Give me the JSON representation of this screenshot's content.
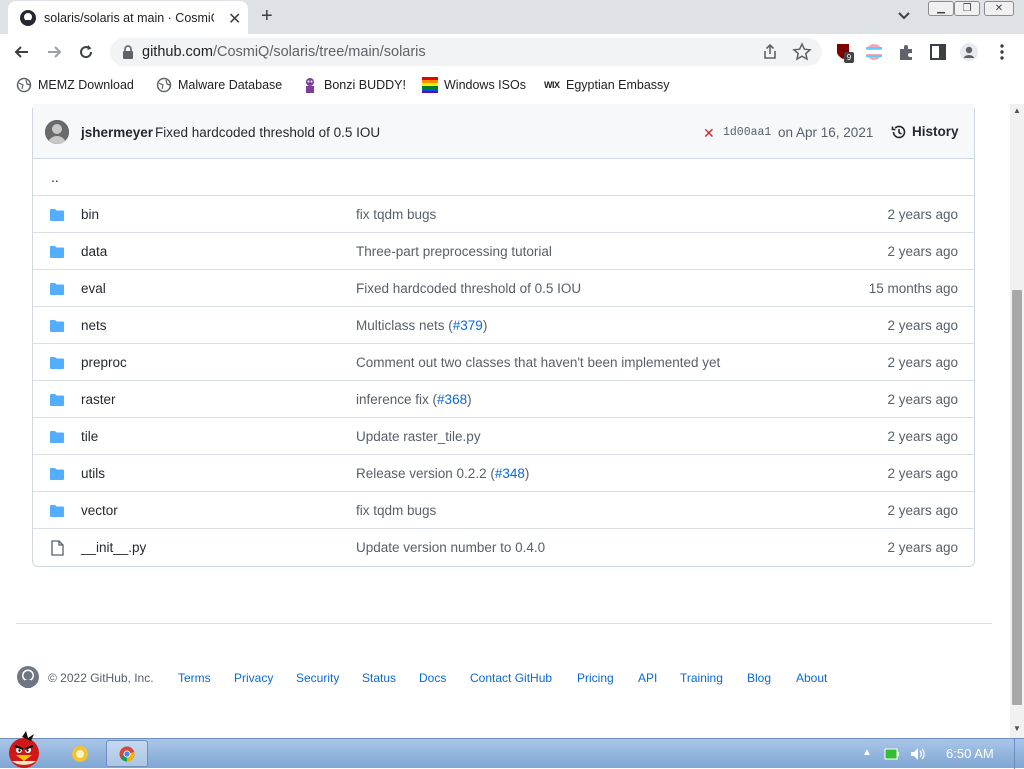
{
  "browser": {
    "tab_title": "solaris/solaris at main · CosmiQ",
    "url_domain": "github.com",
    "url_path": "/CosmiQ/solaris/tree/main/solaris",
    "extension_badge": "9",
    "bookmarks": [
      {
        "label": "MEMZ Download",
        "icon": "globe-icon"
      },
      {
        "label": "Malware Database",
        "icon": "globe-icon"
      },
      {
        "label": "Bonzi BUDDY!",
        "icon": "bonzi-icon"
      },
      {
        "label": "Windows ISOs",
        "icon": "windows-icon"
      },
      {
        "label": "Egyptian Embassy",
        "icon": "wix-icon"
      }
    ]
  },
  "commit": {
    "author": "jshermeyer",
    "message": "Fixed hardcoded threshold of 0.5 IOU",
    "status_symbol": "✕",
    "sha": "1d00aa1",
    "date": "on Apr 16, 2021",
    "history_label": "History"
  },
  "parent_dir": "..",
  "files": [
    {
      "name": "bin",
      "type": "folder",
      "message": "fix tqdm bugs",
      "link": "",
      "suffix": "",
      "age": "2 years ago"
    },
    {
      "name": "data",
      "type": "folder",
      "message": "Three-part preprocessing tutorial",
      "link": "",
      "suffix": "",
      "age": "2 years ago"
    },
    {
      "name": "eval",
      "type": "folder",
      "message": "Fixed hardcoded threshold of 0.5 IOU",
      "link": "",
      "suffix": "",
      "age": "15 months ago"
    },
    {
      "name": "nets",
      "type": "folder",
      "message": "Multiclass nets (",
      "link": "#379",
      "suffix": ")",
      "age": "2 years ago"
    },
    {
      "name": "preproc",
      "type": "folder",
      "message": "Comment out two classes that haven't been implemented yet",
      "link": "",
      "suffix": "",
      "age": "2 years ago"
    },
    {
      "name": "raster",
      "type": "folder",
      "message": "inference fix (",
      "link": "#368",
      "suffix": ")",
      "age": "2 years ago"
    },
    {
      "name": "tile",
      "type": "folder",
      "message": "Update raster_tile.py",
      "link": "",
      "suffix": "",
      "age": "2 years ago"
    },
    {
      "name": "utils",
      "type": "folder",
      "message": "Release version 0.2.2 (",
      "link": "#348",
      "suffix": ")",
      "age": "2 years ago"
    },
    {
      "name": "vector",
      "type": "folder",
      "message": "fix tqdm bugs",
      "link": "",
      "suffix": "",
      "age": "2 years ago"
    },
    {
      "name": "__init__.py",
      "type": "file",
      "message": "Update version number to 0.4.0",
      "link": "",
      "suffix": "",
      "age": "2 years ago"
    }
  ],
  "footer": {
    "copyright": "© 2022 GitHub, Inc.",
    "links": [
      "Terms",
      "Privacy",
      "Security",
      "Status",
      "Docs",
      "Contact GitHub",
      "Pricing",
      "API",
      "Training",
      "Blog",
      "About"
    ]
  },
  "taskbar": {
    "time": "6:50 AM"
  },
  "colors": {
    "link": "#0969da",
    "folder": "#54aeff",
    "fail": "#cf222e",
    "taskbar": "#8fb3de"
  }
}
